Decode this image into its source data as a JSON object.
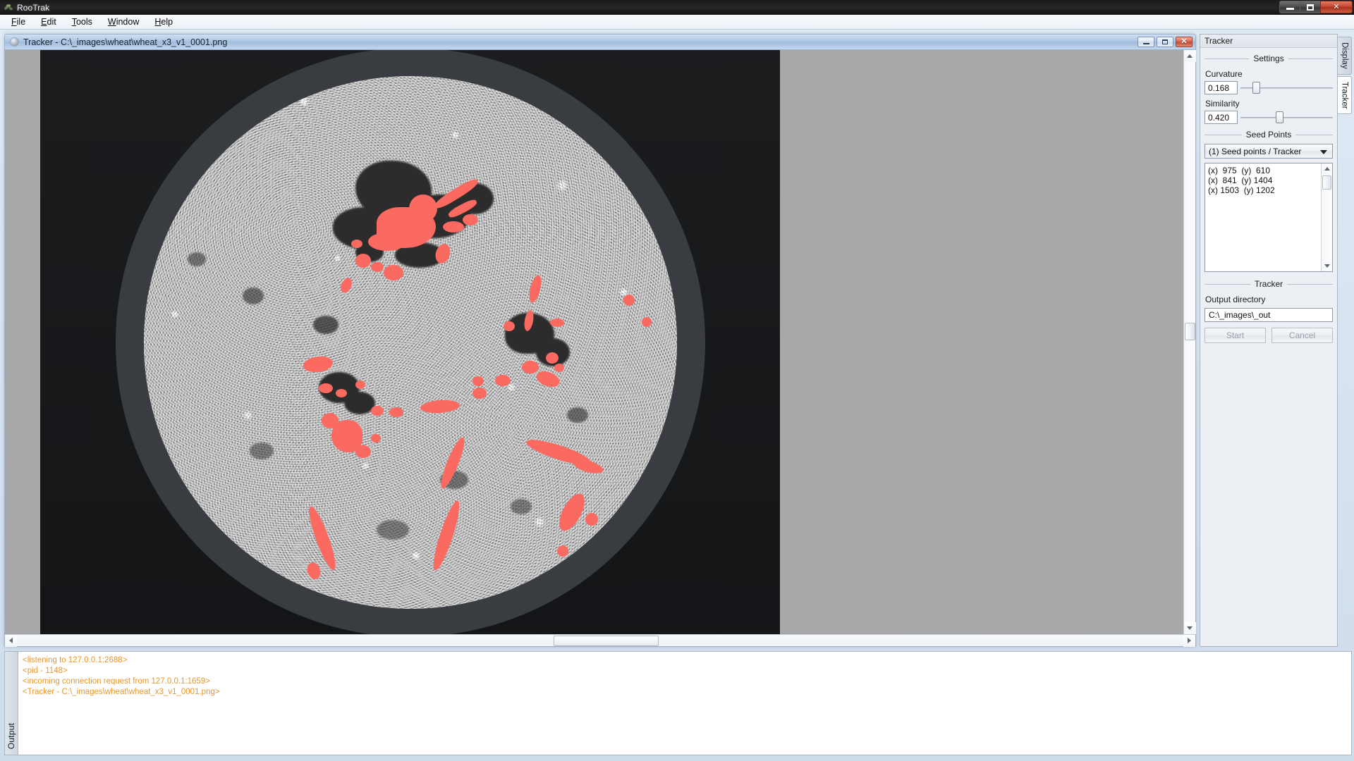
{
  "app": {
    "title": "RooTrak",
    "icon": "rootrak-app-icon",
    "window_controls": {
      "minimize": "minimize",
      "restore": "restore",
      "close": "close"
    }
  },
  "menu": {
    "items": [
      {
        "label": "File",
        "mnemonic": "F"
      },
      {
        "label": "Edit",
        "mnemonic": "E"
      },
      {
        "label": "Tools",
        "mnemonic": "T"
      },
      {
        "label": "Window",
        "mnemonic": "W"
      },
      {
        "label": "Help",
        "mnemonic": "H"
      }
    ]
  },
  "mdi_child": {
    "title": "Tracker - C:\\_images\\wheat\\wheat_x3_v1_0001.png",
    "icon": "image-document-icon",
    "buttons": {
      "minimize": "minimize",
      "maximize": "maximize",
      "close": "close"
    },
    "viewport": {
      "image_name": "wheat_x3_v1_0001.png",
      "description": "X-ray CT cross-section slice of a soil core with red-highlighted root segments",
      "vertical_scroll_position_percent": 48,
      "horizontal_scroll_position_percent": 50
    }
  },
  "output_dock": {
    "tab_label": "Output",
    "log_lines": [
      "<listening to 127.0.0.1:2688>",
      "<pid - 1148>",
      "<incoming connection request from 127.0.0.1:1659>",
      "<Tracker - C:\\_images\\wheat\\wheat_x3_v1_0001.png>"
    ],
    "log_color": "#e8962e"
  },
  "right_dock": {
    "tabs": [
      {
        "label": "Display",
        "active": false
      },
      {
        "label": "Tracker",
        "active": true
      }
    ],
    "panel": {
      "caption": "Tracker",
      "groups": {
        "settings": {
          "title": "Settings",
          "curvature": {
            "label": "Curvature",
            "value": "0.168",
            "slider_percent": 17
          },
          "similarity": {
            "label": "Similarity",
            "value": "0.420",
            "slider_percent": 42
          }
        },
        "seed_points": {
          "title": "Seed Points",
          "selected_source": "(1) Seed points / Tracker",
          "columns": [
            "(x)",
            "(y)"
          ],
          "rows": [
            {
              "x": "975",
              "y": "610"
            },
            {
              "x": "841",
              "y": "1404"
            },
            {
              "x": "1503",
              "y": "1202"
            }
          ]
        },
        "tracker": {
          "title": "Tracker",
          "output_directory_label": "Output directory",
          "output_directory_value": "C:\\_images\\_out",
          "start_button": "Start",
          "cancel_button": "Cancel",
          "buttons_enabled": false
        }
      }
    }
  },
  "colors": {
    "root_overlay": "#fa6a61",
    "log_text": "#e8962e",
    "title_bar": "#1c1c1c",
    "mdi_title_bar": "#aec6e2",
    "panel_bg": "#eceff3"
  }
}
